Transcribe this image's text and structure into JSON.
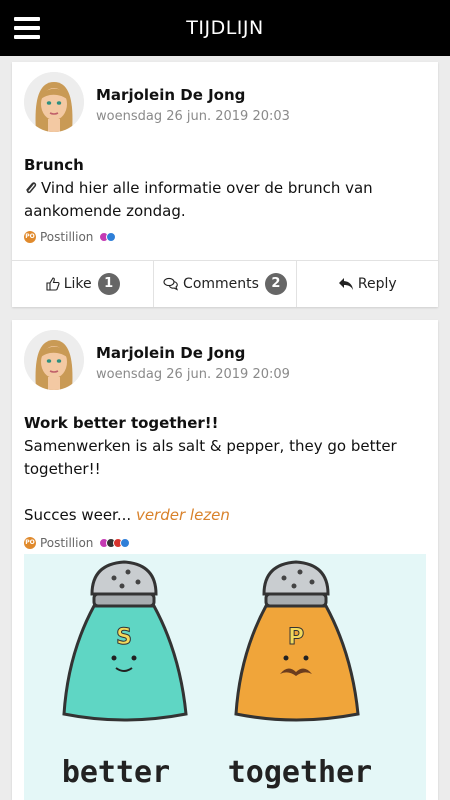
{
  "header": {
    "title": "TIJDLIJN"
  },
  "posts": [
    {
      "author": "Marjolein De Jong",
      "date": "woensdag 26 jun. 2019 20:03",
      "title": "Brunch",
      "line1": "Vind hier alle informatie over de brunch van",
      "line2": "aankomende zondag.",
      "source": "Postillion",
      "source_badge": "PO",
      "like_label": "Like",
      "like_count": "1",
      "comments_label": "Comments",
      "comments_count": "2",
      "reply_label": "Reply"
    },
    {
      "author": "Marjolein De Jong",
      "date": "woensdag 26 jun. 2019 20:09",
      "title": "Work better together!!",
      "line1": "Samenwerken is als salt & pepper, they go better",
      "line2": "together!!",
      "line3": "Succes weer...",
      "read_more": "verder lezen",
      "source": "Postillion",
      "source_badge": "PO",
      "image": {
        "salt_letter": "S",
        "pepper_letter": "P",
        "caption_left": "better",
        "caption_right": "together"
      }
    }
  ],
  "colors": {
    "accent": "#d9822b",
    "badge": "#666666",
    "salt": "#5fd6c4",
    "pepper": "#f0a53a"
  }
}
